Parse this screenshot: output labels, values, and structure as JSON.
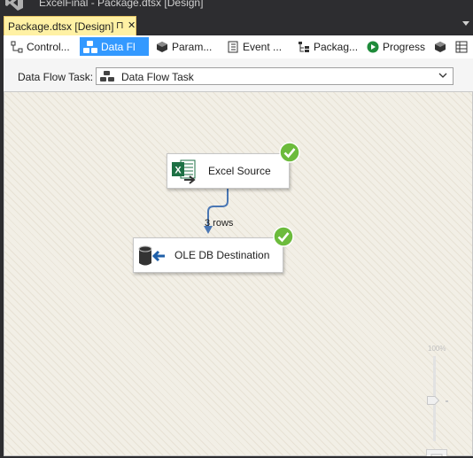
{
  "window": {
    "title": "ExcelFinal - Package.dtsx [Design]"
  },
  "document_tab": {
    "label": "Package.dtsx [Design]",
    "pin_glyph": "⊓",
    "close_glyph": "✕"
  },
  "designer_tabs": [
    {
      "label": "Control...",
      "icon": "control-flow-icon",
      "active": false
    },
    {
      "label": "Data Fl",
      "icon": "data-flow-icon",
      "active": true
    },
    {
      "label": "Param...",
      "icon": "parameters-icon",
      "active": false
    },
    {
      "label": "Event ...",
      "icon": "event-handlers-icon",
      "active": false
    },
    {
      "label": "Packag...",
      "icon": "package-explorer-icon",
      "active": false
    },
    {
      "label": "Progress",
      "icon": "progress-play-icon",
      "active": false
    },
    {
      "label": "",
      "icon": "connection-managers-icon",
      "active": false
    },
    {
      "label": "",
      "icon": "table-icon",
      "active": false
    }
  ],
  "task_selector": {
    "label": "Data Flow Task:",
    "value": "Data Flow Task",
    "icon": "data-flow-task-icon"
  },
  "components": {
    "excel_source": {
      "label": "Excel Source",
      "icon": "excel-source-icon",
      "status": "success"
    },
    "oledb_destination": {
      "label": "OLE DB Destination",
      "icon": "oledb-destination-icon",
      "status": "success"
    }
  },
  "path": {
    "label": "3 rows"
  },
  "zoom": {
    "label": "100%"
  },
  "colors": {
    "tab_active": "#3399ff",
    "doc_tab": "#fff1a4",
    "success_badge": "#6cbb3c",
    "path_line": "#4a77b4",
    "canvas": "#f2efe6"
  }
}
